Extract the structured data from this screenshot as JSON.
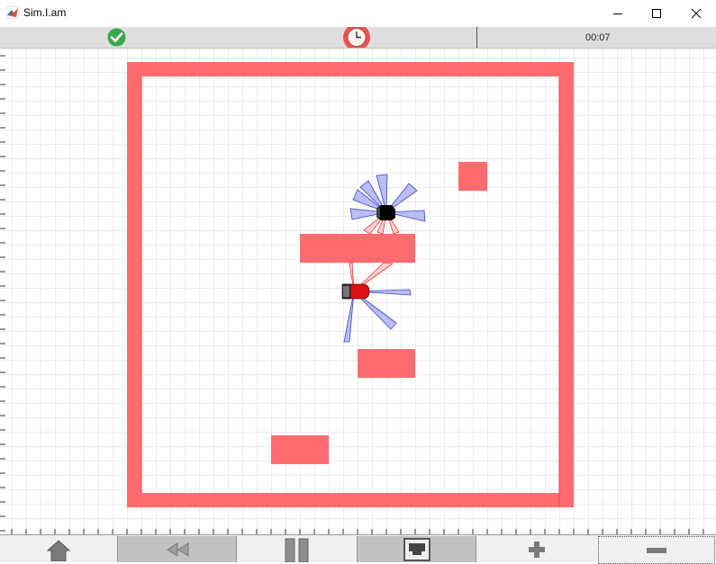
{
  "window": {
    "title": "Sim.I.am",
    "minimize_icon": "minimize-icon",
    "maximize_icon": "maximize-icon",
    "close_icon": "close-icon"
  },
  "status": {
    "ok_icon": "check-circle-icon",
    "clock_icon": "clock-icon",
    "elapsed_time": "00:07",
    "ok_color": "#3aa84a",
    "clock_color": "#e8534f"
  },
  "simulation": {
    "obstacle_color": "#ff6b6e",
    "grid_color": "#d8d8d8",
    "ir_sensor_color": "#6b74e6",
    "ir_sensor_hit_color": "#ee3b3b",
    "robot_1": {
      "body_color": "#dd1111",
      "label": ""
    },
    "robot_2": {
      "body_color": "#000000",
      "label": ""
    }
  },
  "toolbar": {
    "buttons": [
      {
        "name": "home",
        "icon": "home-icon"
      },
      {
        "name": "rewind",
        "icon": "rewind-icon"
      },
      {
        "name": "pause",
        "icon": "pause-icon"
      },
      {
        "name": "network",
        "icon": "network-port-icon"
      },
      {
        "name": "zoom-in",
        "icon": "plus-icon"
      },
      {
        "name": "zoom-out",
        "icon": "minus-icon"
      }
    ]
  }
}
